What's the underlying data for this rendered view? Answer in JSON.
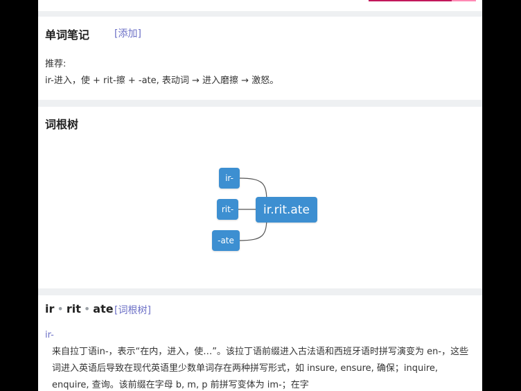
{
  "word_notes": {
    "title": "单词笔记",
    "add_label": "[添加]",
    "recommend_label": "推荐:",
    "recommend_text": "ir-进入，使 + rit-擦 + -ate, 表动词 → 进入磨擦 → 激怒。"
  },
  "word_root_tree": {
    "title": "词根树",
    "nodes": [
      "ir-",
      "rit-",
      "-ate"
    ],
    "root_word": "ir.rit.ate",
    "node_color": "#3d8fd1"
  },
  "etymology": {
    "parts": [
      "ir",
      "rit",
      "ate"
    ],
    "tree_link_label": "[词根树]",
    "prefix": "ir-",
    "description": "来自拉丁语in-，表示“在内，进入，使…”。该拉丁语前缀进入古法语和西班牙语时拼写演变为 en-，这些词进入英语后导致在现代英语里少数单词存在两种拼写形式，如 insure, ensure, 确保；inquire, enquire, 查询。该前缀在字母 b, m, p 前拼写变体为 im-；在字"
  },
  "colors": {
    "link": "#6b6fc6",
    "accent": "#c2185b"
  }
}
